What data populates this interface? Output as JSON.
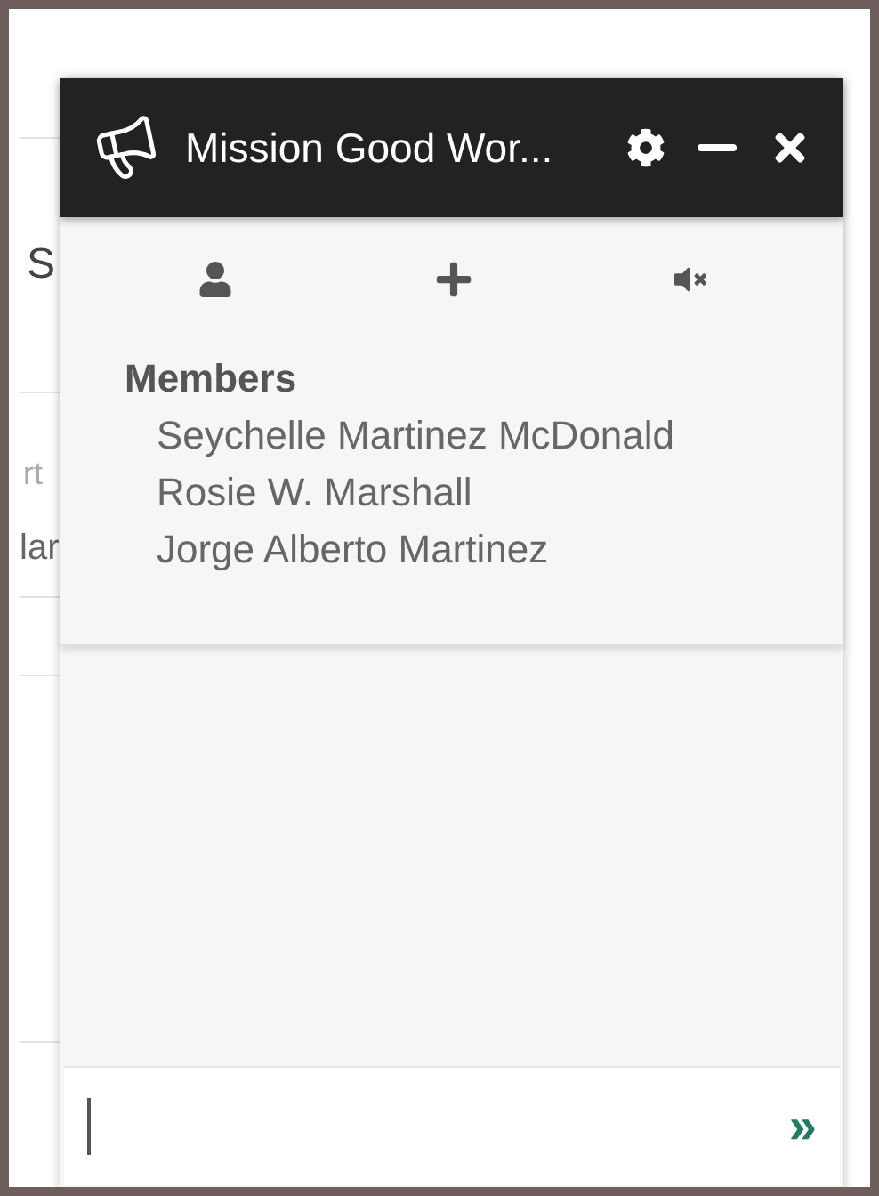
{
  "background": {
    "texts": [
      "S",
      "rt",
      "lar"
    ]
  },
  "chat_window": {
    "title": "Mission Good Wor...",
    "toolbar": [
      {
        "kind": "person"
      },
      {
        "kind": "add"
      },
      {
        "kind": "mute"
      }
    ],
    "members": {
      "heading": "Members",
      "names": [
        "Seychelle Martinez McDonald",
        "Rosie W. Marshall",
        "Jorge Alberto Martinez"
      ]
    },
    "composer": {
      "send": "»"
    }
  }
}
